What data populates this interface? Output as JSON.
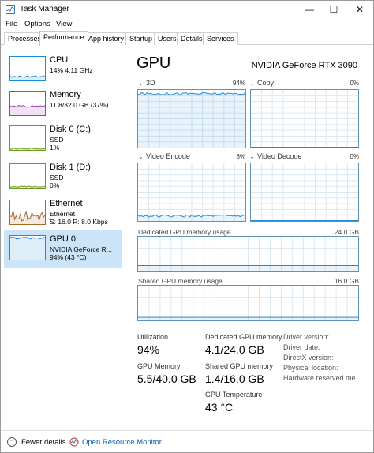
{
  "window": {
    "title": "Task Manager"
  },
  "controls": {
    "minimize": "—",
    "maximize": "☐",
    "close": "✕"
  },
  "menu": [
    "File",
    "Options",
    "View"
  ],
  "tabs": [
    "Processes",
    "Performance",
    "App history",
    "Startup",
    "Users",
    "Details",
    "Services"
  ],
  "active_tab": "Performance",
  "resources": [
    {
      "name": "CPU",
      "line1": "14% 4.11 GHz",
      "line2": "",
      "color": "#1e8ad6",
      "level": 0.14
    },
    {
      "name": "Memory",
      "line1": "11.8/32.0 GB (37%)",
      "line2": "",
      "color": "#9c3fb0",
      "level": 0.37
    },
    {
      "name": "Disk 0 (C:)",
      "line1": "SSD",
      "line2": "1%",
      "color": "#6c9a1a",
      "level": 0.01
    },
    {
      "name": "Disk 1 (D:)",
      "line1": "SSD",
      "line2": "0%",
      "color": "#6c9a1a",
      "level": 0.0
    },
    {
      "name": "Ethernet",
      "line1": "Ethernet",
      "line2": "S: 16.0 R: 8.0 Kbps",
      "color": "#a86a2c",
      "level": 0.3
    },
    {
      "name": "GPU 0",
      "line1": "NVIDIA GeForce R...",
      "line2": "94% (43 °C)",
      "color": "#1e8ad6",
      "level": 0.94
    }
  ],
  "gpu": {
    "title": "GPU",
    "model": "NVIDIA GeForce RTX 3090",
    "graphs": [
      {
        "label": "3D",
        "percent": "94%",
        "level": 0.94
      },
      {
        "label": "Copy",
        "percent": "0%",
        "level": 0.0
      },
      {
        "label": "Video Encode",
        "percent": "8%",
        "level": 0.08
      },
      {
        "label": "Video Decode",
        "percent": "0%",
        "level": 0.0
      }
    ],
    "dedicated_memory_label": "Dedicated GPU memory usage",
    "dedicated_memory_max": "24.0 GB",
    "shared_memory_label": "Shared GPU memory usage",
    "shared_memory_max": "16.0 GB",
    "stats": {
      "utilization_label": "Utilization",
      "utilization": "94%",
      "dedicated_label": "Dedicated GPU memory",
      "dedicated": "4.1/24.0 GB",
      "gpu_memory_label": "GPU Memory",
      "gpu_memory": "5.5/40.0 GB",
      "shared_label": "Shared GPU memory",
      "shared": "1.4/16.0 GB",
      "temp_label": "GPU Temperature",
      "temp": "43 °C"
    },
    "info": [
      "Driver version:",
      "Driver date:",
      "DirectX version:",
      "Physical location:",
      "Hardware reserved me..."
    ]
  },
  "footer": {
    "fewer_details": "Fewer details",
    "open_monitor": "Open Resource Monitor"
  }
}
